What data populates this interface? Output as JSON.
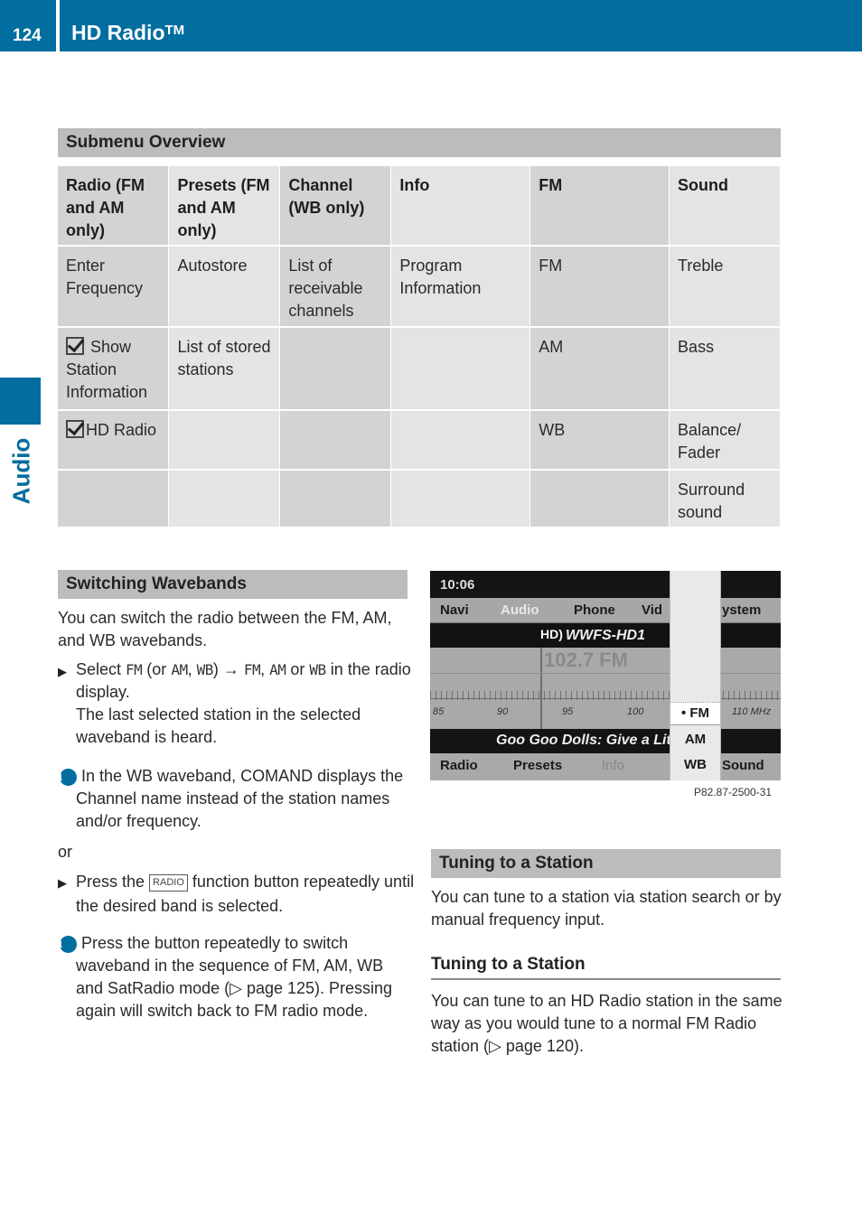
{
  "header": {
    "page_number": "124",
    "title": "HD Radio",
    "trademark": "TM",
    "accent_color": "#026d9f"
  },
  "side_tab": {
    "label": "Audio"
  },
  "submenu": {
    "heading": "Submenu Overview",
    "columns": [
      "Radio (FM and AM only)",
      "Presets (FM and AM only)",
      "Channel (WB only)",
      "Info",
      "FM",
      "Sound"
    ],
    "rows": [
      [
        "Enter Frequency",
        "Autostore",
        "List of receivable channels",
        "Program Information",
        "FM",
        "Treble"
      ],
      [
        "Show Station Information",
        "List of stored stations",
        "",
        "",
        "AM",
        "Bass"
      ],
      [
        "HD Radio",
        "",
        "",
        "",
        "WB",
        "Balance/ Fader"
      ],
      [
        "",
        "",
        "",
        "",
        "",
        "Surround sound"
      ]
    ],
    "checkbox_icon": "checkbox-checked-icon"
  },
  "switching": {
    "heading": "Switching Wavebands",
    "intro": "You can switch the radio between the FM, AM, and WB wavebands.",
    "step1": {
      "t1": "Select ",
      "k1": "FM",
      "t2": " (or ",
      "k2": "AM",
      "t3": ", ",
      "k3": "WB",
      "t4": ") → ",
      "k4": "FM",
      "t5": ", ",
      "k5": "AM",
      "t6": " or ",
      "k6": "WB",
      "t7": " in the radio display.",
      "result": "The last selected station in the selected waveband is heard."
    },
    "info1": "In the WB waveband, COMAND displays the Channel name instead of the station names and/or frequency.",
    "or": "or",
    "step2": {
      "before": "Press the ",
      "key": "RADIO",
      "after": " function button repeatedly until the desired band is selected."
    },
    "info2": "Press the button repeatedly to switch waveband in the sequence of FM, AM, WB and SatRadio mode (▷ page 125). Pressing again will switch back to FM radio mode."
  },
  "display": {
    "time": "10:06",
    "menu": [
      "Navi",
      "Audio",
      "Phone",
      "Vid",
      "ystem"
    ],
    "hd_logo": "HD)",
    "station": "WWFS-HD1",
    "frequency": "102.7 FM",
    "scale": [
      "85",
      "90",
      "95",
      "100",
      "110 MHz"
    ],
    "ticker": "Goo Goo Dolls: Give a Lit",
    "bottom": [
      "Radio",
      "Presets",
      "Info",
      "Sound"
    ],
    "popup": [
      "• FM",
      "AM",
      "WB"
    ],
    "selected_band": "FM",
    "caption": "P82.87-2500-31"
  },
  "tuning": {
    "heading": "Tuning to a Station",
    "intro": "You can tune to a station via station search or by manual frequency input.",
    "subheading": "Tuning to a Station",
    "body": "You can tune to an HD Radio station in the same way as you would tune to a normal FM Radio station (▷ page 120)."
  }
}
